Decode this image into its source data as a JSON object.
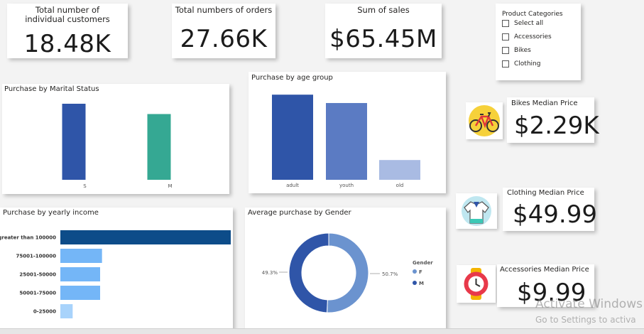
{
  "kpis": {
    "customers": {
      "title": "Total number of individual customers",
      "value": "18.48K"
    },
    "orders": {
      "title": "Total numbers of orders",
      "value": "27.66K"
    },
    "sales": {
      "title": "Sum of sales",
      "value": "$65.45M"
    }
  },
  "slicer": {
    "title": "Product Categories",
    "items": [
      "Select all",
      "Accessories",
      "Bikes",
      "Clothing"
    ]
  },
  "median_prices": {
    "bikes": {
      "title": "Bikes Median Price",
      "value": "$2.29K",
      "icon": "bicycle-icon"
    },
    "clothing": {
      "title": "Clothing Median Price",
      "value": "$49.99",
      "icon": "shirt-icon"
    },
    "accessories": {
      "title": "Accessories Median Price",
      "value": "$9.99",
      "icon": "watch-icon"
    }
  },
  "colors": {
    "navy": "#2f55a8",
    "teal": "#35a893",
    "age_adult": "#2f55a8",
    "age_youth": "#5b7bc3",
    "age_old": "#a9bbe3",
    "income_top": "#0d4c89",
    "income_mid": "#74b6f7",
    "income_low": "#a8d3fb",
    "gender_f": "#6b93cf",
    "gender_m": "#2f55a8"
  },
  "watermark": {
    "line1": "Activate Windows",
    "line2": "Go to Settings to activa"
  },
  "chart_data": [
    {
      "type": "bar",
      "title": "Purchase by Marital Status",
      "categories": [
        "S",
        "M"
      ],
      "values": [
        9909,
        8567
      ],
      "ylim": [
        0,
        10000
      ]
    },
    {
      "type": "bar",
      "title": "Purchase by age group",
      "categories": [
        "adult",
        "youth",
        "old"
      ],
      "values": [
        11200,
        10100,
        2600
      ],
      "ylim": [
        0,
        11500
      ]
    },
    {
      "type": "bar",
      "orientation": "horizontal",
      "title": "Purchase by yearly income",
      "categories": [
        "greater than 100000",
        "75001-100000",
        "25001-50000",
        "50001-75000",
        "0-25000"
      ],
      "values": [
        9000,
        2200,
        2100,
        2100,
        650
      ]
    },
    {
      "type": "pie",
      "subtype": "donut",
      "title": "Average purchase by Gender",
      "legend_title": "Gender",
      "labels": [
        "F",
        "M"
      ],
      "values": [
        50.7,
        49.3
      ],
      "value_labels": [
        "50.7%",
        "49.3%"
      ]
    }
  ]
}
